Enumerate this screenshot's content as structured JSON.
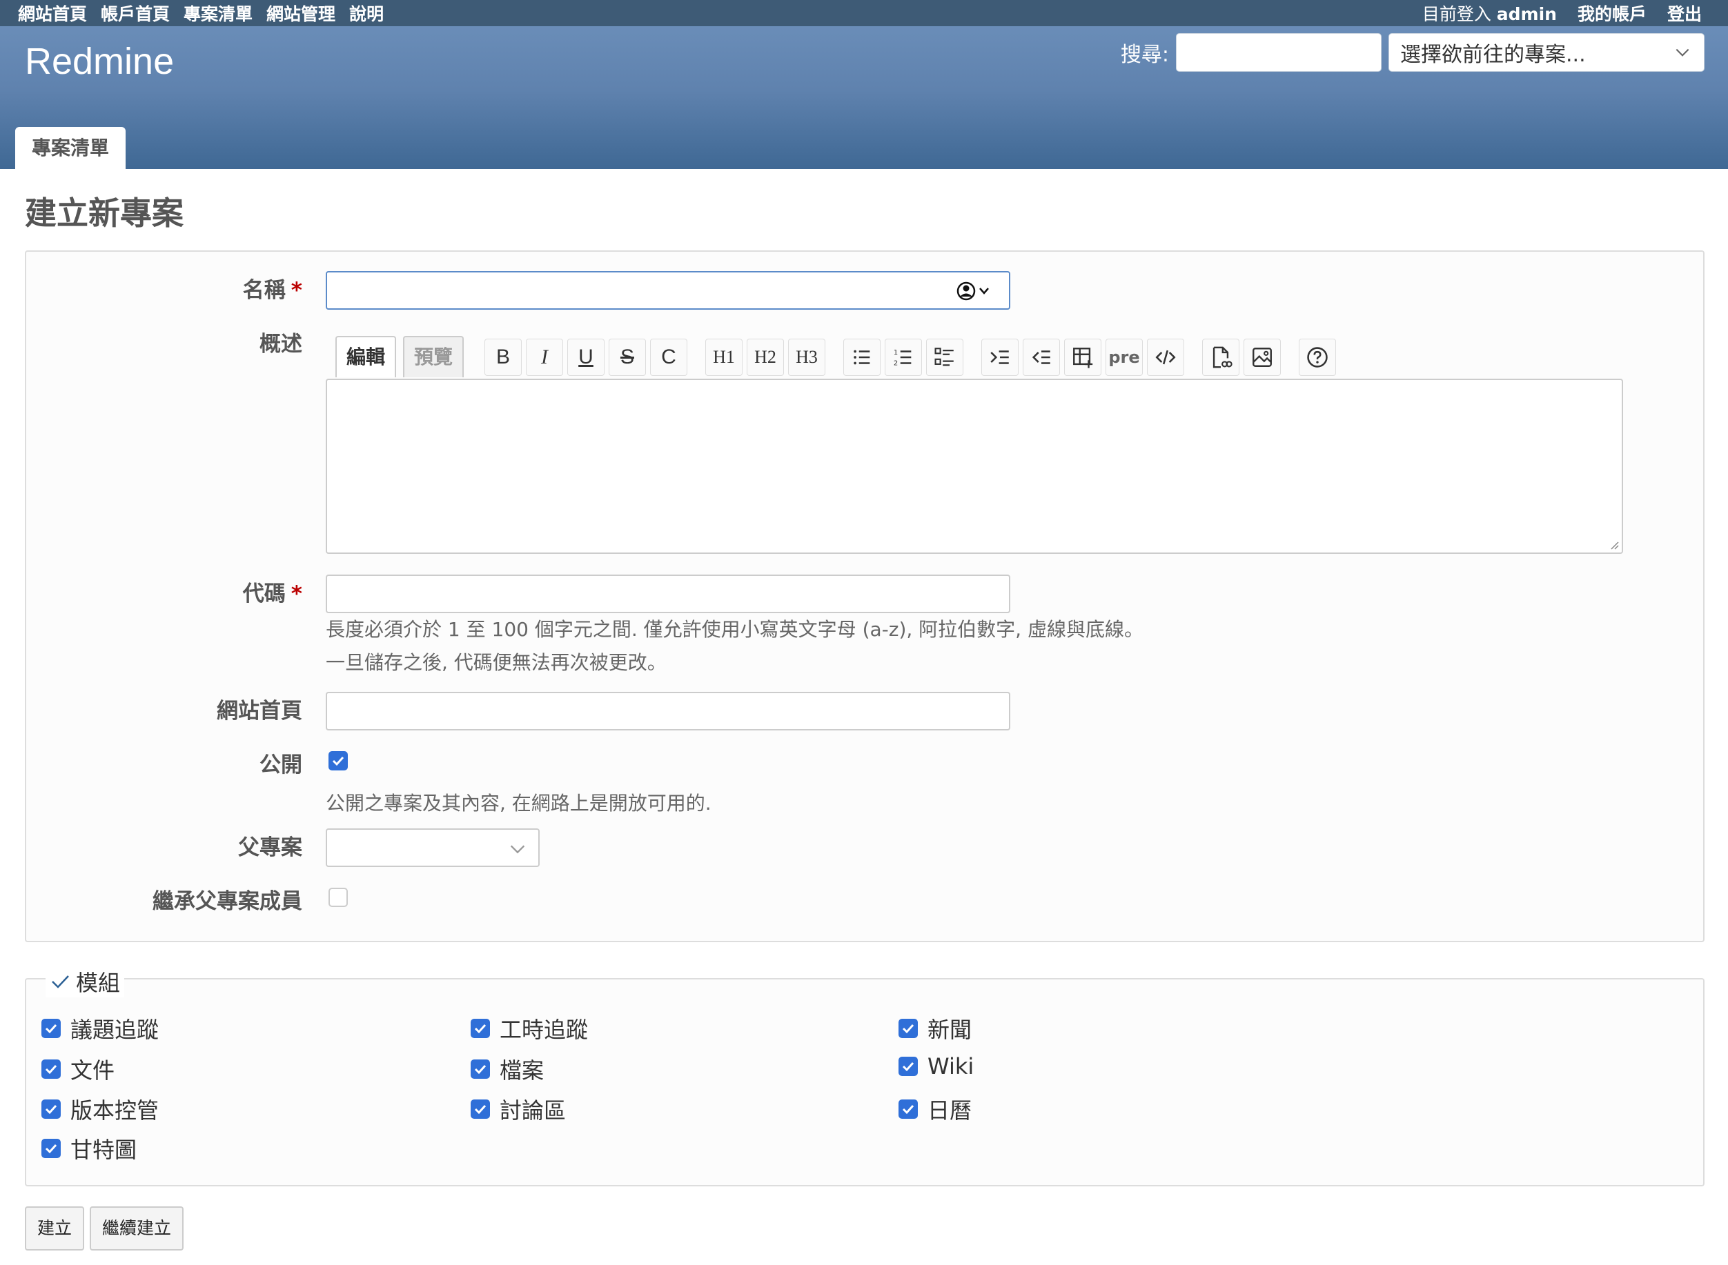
{
  "top_menu": {
    "items": [
      "網站首頁",
      "帳戶首頁",
      "專案清單",
      "網站管理",
      "說明"
    ],
    "logged_as_prefix": "目前登入",
    "user": "admin",
    "my_account": "我的帳戶",
    "logout": "登出"
  },
  "header": {
    "app_title": "Redmine",
    "search_label": "搜尋:",
    "search_value": "",
    "project_jump": "選擇欲前往的專案..."
  },
  "main_menu": {
    "tab": "專案清單"
  },
  "page_title": "建立新專案",
  "form": {
    "name_label": "名稱",
    "required_mark": "*",
    "description_label": "概述",
    "wiki_tabs": {
      "edit": "編輯",
      "preview": "預覽"
    },
    "toolbar": {
      "bold": "B",
      "italic": "I",
      "underline": "U",
      "strike": "S",
      "code": "C",
      "h1": "H1",
      "h2": "H2",
      "h3": "H3",
      "pre": "pre"
    },
    "identifier_label": "代碼",
    "identifier_info_1": "長度必須介於 1 至 100 個字元之間. 僅允許使用小寫英文字母 (a-z), 阿拉伯數字, 虛線與底線。",
    "identifier_info_2": "一旦儲存之後, 代碼便無法再次被更改。",
    "homepage_label": "網站首頁",
    "public_label": "公開",
    "public_checked": true,
    "public_info": "公開之專案及其內容, 在網路上是開放可用的.",
    "parent_label": "父專案",
    "inherit_label": "繼承父專案成員",
    "inherit_checked": false
  },
  "modules": {
    "legend": "模組",
    "items": [
      {
        "label": "議題追蹤",
        "checked": true
      },
      {
        "label": "工時追蹤",
        "checked": true
      },
      {
        "label": "新聞",
        "checked": true
      },
      {
        "label": "文件",
        "checked": true
      },
      {
        "label": "檔案",
        "checked": true
      },
      {
        "label": "Wiki",
        "checked": true
      },
      {
        "label": "版本控管",
        "checked": true
      },
      {
        "label": "討論區",
        "checked": true
      },
      {
        "label": "日曆",
        "checked": true
      },
      {
        "label": "甘特圖",
        "checked": true
      }
    ]
  },
  "buttons": {
    "create": "建立",
    "create_continue": "繼續建立"
  },
  "colors": {
    "top_menu": "#3e5b76",
    "header": "#628db6",
    "checkbox": "#2f6fd8",
    "required": "#bb0000"
  }
}
